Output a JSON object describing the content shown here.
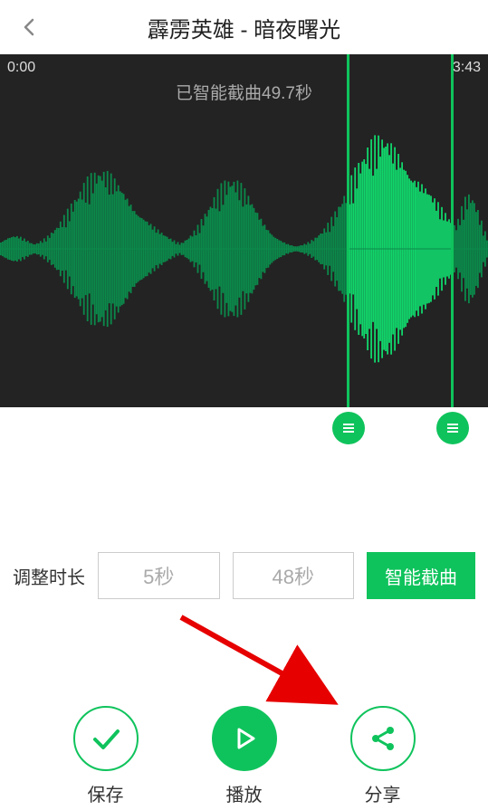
{
  "header": {
    "title": "霹雳英雄 - 暗夜曙光"
  },
  "waveform": {
    "start_time": "0:00",
    "end_time": "3:43",
    "smart_message": "已智能截曲49.7秒"
  },
  "duration": {
    "label": "调整时长",
    "field1": "5秒",
    "field2": "48秒",
    "smart_btn": "智能截曲"
  },
  "actions": {
    "save": "保存",
    "play": "播放",
    "share": "分享"
  },
  "colors": {
    "accent": "#0fc35c",
    "wave_bg": "#232323",
    "wave": "#0b7d45"
  }
}
